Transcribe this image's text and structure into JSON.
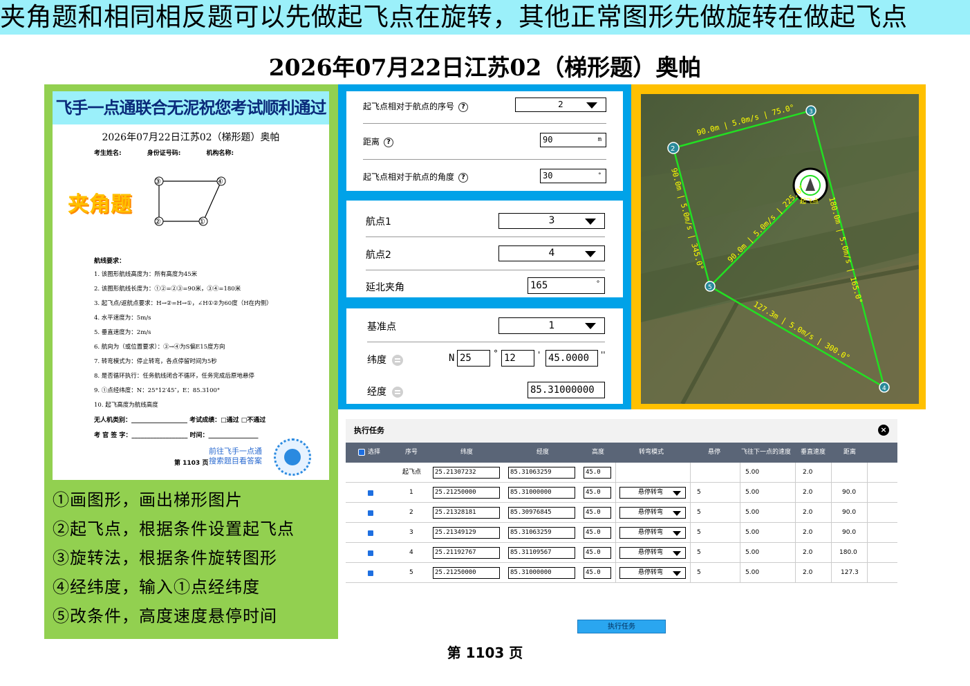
{
  "banner": "夹角题和相同相反题可以先做起飞点在旋转，其他正常图形先做旋转在做起飞点",
  "page_title": "2026年07月22日江苏02（梯形题）奥帕",
  "doc": {
    "header": "飞手一点通联合无泥祝您考试顺利通过",
    "title": "2026年07月22日江苏02（梯形题）奥帕",
    "info": [
      "考生姓名:",
      "身份证号码:",
      "机构名称:"
    ],
    "badge": "夹角题",
    "shape_labels": [
      "①",
      "②",
      "③",
      "④"
    ],
    "req_head": "航线要求：",
    "requirements": [
      "1.  该图形航线高度为：所有高度为45米",
      "2.  该图形航线长度为：①②=②③=90米，③④=180米",
      "3.  起飞点/返航点要求：H→②=H→①，∠H①②为60度（H在内侧）",
      "4.  水平速度为：5m/s",
      "5.  垂直速度为：2m/s",
      "6.  航向为（或位置要求）：③→④为S偏E15度方向",
      "7.  转弯模式为：停止转弯，各点停留时间为5秒",
      "8.  是否循环执行：任务航线闭合不循环，任务完成后原地悬停",
      "9.  ①点经纬度：N：25°12′45″，E：85.3100°",
      "10. 起飞高度为航线高度"
    ],
    "foot1": "无人机类别：__________________ 考试成绩：□通过  □不通过",
    "foot2": "考 官 签 字：__________________ 时间：________________",
    "link1": "前往飞手一点通",
    "link2": "搜索题目看答案",
    "page": "第  1103  页"
  },
  "steps": [
    "①画图形，画出梯形图片",
    "②起飞点，根据条件设置起飞点",
    "③旋转法，根据条件旋转图形",
    "④经纬度，输入①点经纬度",
    "⑤改条件，高度速度悬停时间"
  ],
  "takeoff": {
    "seq_label": "起飞点相对于航点的序号",
    "seq_value": "2",
    "dist_label": "距离",
    "dist_value": "90",
    "dist_unit": "m",
    "angle_label": "起飞点相对于航点的角度",
    "angle_value": "30",
    "angle_unit": "°"
  },
  "rotate": {
    "wp1_label": "航点1",
    "wp1_value": "3",
    "wp2_label": "航点2",
    "wp2_value": "4",
    "angle_label": "延北夹角",
    "angle_value": "165",
    "angle_unit": "°"
  },
  "coords": {
    "base_label": "基准点",
    "base_value": "1",
    "lat_label": "纬度",
    "lat_dir": "N",
    "lat_deg": "25",
    "lat_min": "12",
    "lat_sec": "45.0000",
    "deg_sym": "°",
    "min_sym": "'",
    "sec_sym": "''",
    "lon_label": "经度",
    "lon_value": "85.31000000"
  },
  "map": {
    "points": [
      "2",
      "3",
      "4",
      "5"
    ],
    "labels": [
      "90.0m | 5.0m/s | 75.0°",
      "180.0m | 5.0m/s | 165.0°",
      "127.3m | 5.0m/s | 300.0°",
      "90.0m | 5.0m/s | 345.0°",
      "90.0m | 5.0m/s | 225.0°"
    ],
    "home_label": "起飞点"
  },
  "task": {
    "title": "执行任务",
    "close": "×",
    "headers": [
      "选择",
      "序号",
      "纬度",
      "经度",
      "高度",
      "转弯模式",
      "悬停",
      "飞往下一点的速度",
      "垂直速度",
      "距离"
    ],
    "rows": [
      {
        "seq": "起飞点",
        "lat": "25.21307232",
        "lon": "85.31063259",
        "alt": "45.0",
        "mode": "",
        "hover": "",
        "speed": "5.00",
        "vspeed": "2.0",
        "dist": ""
      },
      {
        "seq": "1",
        "lat": "25.21250000",
        "lon": "85.31000000",
        "alt": "45.0",
        "mode": "悬停转弯",
        "hover": "5",
        "speed": "5.00",
        "vspeed": "2.0",
        "dist": "90.0"
      },
      {
        "seq": "2",
        "lat": "25.21328181",
        "lon": "85.30976845",
        "alt": "45.0",
        "mode": "悬停转弯",
        "hover": "5",
        "speed": "5.00",
        "vspeed": "2.0",
        "dist": "90.0"
      },
      {
        "seq": "3",
        "lat": "25.21349129",
        "lon": "85.31063259",
        "alt": "45.0",
        "mode": "悬停转弯",
        "hover": "5",
        "speed": "5.00",
        "vspeed": "2.0",
        "dist": "90.0"
      },
      {
        "seq": "4",
        "lat": "25.21192767",
        "lon": "85.31109567",
        "alt": "45.0",
        "mode": "悬停转弯",
        "hover": "5",
        "speed": "5.00",
        "vspeed": "2.0",
        "dist": "180.0"
      },
      {
        "seq": "5",
        "lat": "25.21250000",
        "lon": "85.31000000",
        "alt": "45.0",
        "mode": "悬停转弯",
        "hover": "5",
        "speed": "5.00",
        "vspeed": "2.0",
        "dist": "127.3"
      }
    ],
    "exec_button": "执行任务"
  },
  "page_number": "第 1103 页",
  "colors": {
    "banner": "#9bf0fa",
    "green": "#92d050",
    "blue": "#00a2e8",
    "orange": "#ffc000",
    "route": "#22e022"
  }
}
